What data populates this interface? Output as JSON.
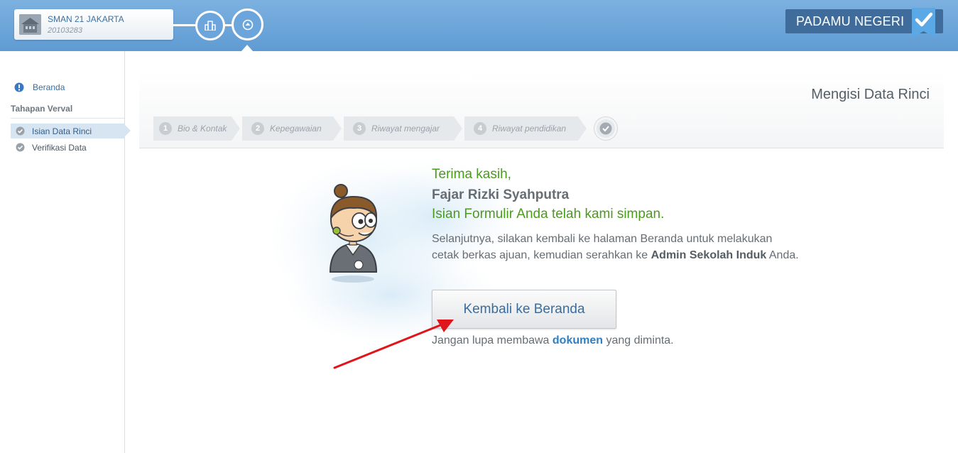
{
  "header": {
    "school_name": "SMAN 21 JAKARTA",
    "school_id": "20103283",
    "brand": "PADAMU NEGERI"
  },
  "sidebar": {
    "home_label": "Beranda",
    "section_title": "Tahapan Verval",
    "items": [
      {
        "label": "Isian Data Rinci",
        "active": true
      },
      {
        "label": "Verifikasi Data",
        "active": false
      }
    ]
  },
  "page": {
    "title": "Mengisi Data Rinci",
    "steps": [
      {
        "num": "1",
        "label": "Bio & Kontak"
      },
      {
        "num": "2",
        "label": "Kepegawaian"
      },
      {
        "num": "3",
        "label": "Riwayat mengajar"
      },
      {
        "num": "4",
        "label": "Riwayat pendidikan"
      }
    ]
  },
  "message": {
    "thanks": "Terima kasih,",
    "person": "Fajar Rizki Syahputra",
    "saved": "Isian Formulir Anda telah kami simpan.",
    "instr_part1": "Selanjutnya, silakan kembali ke halaman Beranda untuk melakukan cetak berkas ajuan, kemudian serahkan ke ",
    "instr_bold": "Admin Sekolah Induk",
    "instr_part2": " Anda.",
    "button_label": "Kembali ke Beranda",
    "note_part1": "Jangan lupa membawa ",
    "note_link": "dokumen",
    "note_part2": " yang diminta."
  },
  "colors": {
    "header_blue": "#6ba5db",
    "brand_navy": "#3f6c9a",
    "success_green": "#4c9a1e",
    "link_blue": "#2e7fc4",
    "annotation_red": "#e0141b"
  }
}
